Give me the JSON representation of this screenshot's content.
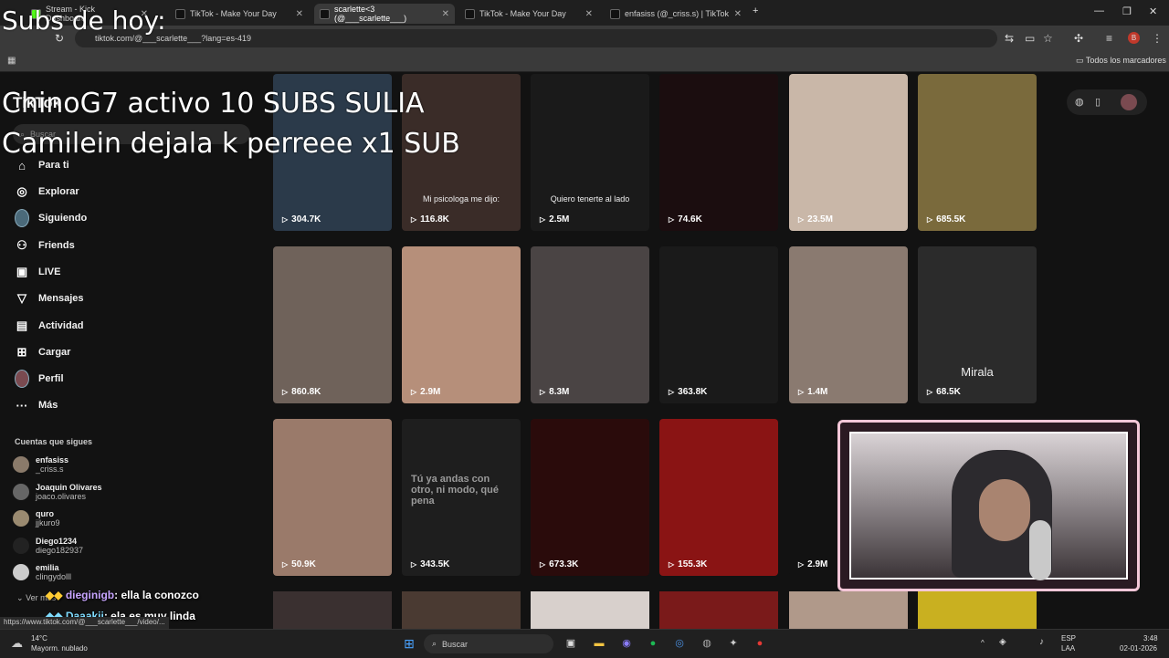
{
  "browser": {
    "tabs": [
      {
        "label": "Stream - Kick Dashboard",
        "active": false
      },
      {
        "label": "TikTok - Make Your Day",
        "active": false
      },
      {
        "label": "scarlette<3 (@___scarlette___)",
        "active": true
      },
      {
        "label": "TikTok - Make Your Day",
        "active": false
      },
      {
        "label": "enfasiss (@_criss.s) | TikTok",
        "active": false
      }
    ],
    "url": "tiktok.com/@___scarlette___?lang=es-419",
    "bookmarks_folder": "Todos los marcadores",
    "status_url": "https://www.tiktok.com/@___scarlette___/video/..."
  },
  "tiktok": {
    "logo": "TikTok",
    "search_placeholder": "Buscar",
    "nav": [
      {
        "label": "Para ti",
        "icon": "home-icon"
      },
      {
        "label": "Explorar",
        "icon": "compass-icon"
      },
      {
        "label": "Siguiendo",
        "icon": "avatar"
      },
      {
        "label": "Friends",
        "icon": "friends-icon"
      },
      {
        "label": "LIVE",
        "icon": "live-icon"
      },
      {
        "label": "Mensajes",
        "icon": "send-icon"
      },
      {
        "label": "Actividad",
        "icon": "activity-icon"
      },
      {
        "label": "Cargar",
        "icon": "upload-icon"
      },
      {
        "label": "Perfil",
        "icon": "profile-avatar"
      },
      {
        "label": "Más",
        "icon": "more-icon"
      }
    ],
    "following_heading": "Cuentas que sigues",
    "following": [
      {
        "name": "enfasiss",
        "handle": "_criss.s"
      },
      {
        "name": "Joaquin Olivares",
        "handle": "joaco.olivares"
      },
      {
        "name": "quro",
        "handle": "jjkuro9"
      },
      {
        "name": "Diego1234",
        "handle": "diego182937"
      },
      {
        "name": "emilia",
        "handle": "clingydolll"
      }
    ],
    "see_more": "Ver más",
    "videos": [
      {
        "views": "304.7K",
        "caption": "",
        "color": "#2b3a4a"
      },
      {
        "views": "116.8K",
        "caption": "Mi psicologa me dijo:",
        "color": "#3a2c28"
      },
      {
        "views": "2.5M",
        "caption": "Quiero tenerte al lado",
        "color": "#1a1a1a"
      },
      {
        "views": "74.6K",
        "caption": "",
        "color": "#1b0d0f"
      },
      {
        "views": "23.5M",
        "caption": "",
        "color": "#c9b7a8"
      },
      {
        "views": "685.5K",
        "caption": "",
        "color": "#7a6a3c"
      },
      {
        "views": "860.8K",
        "caption": "",
        "color": "#6f625a"
      },
      {
        "views": "2.9M",
        "caption": "",
        "color": "#b68f7a"
      },
      {
        "views": "8.3M",
        "caption": "",
        "color": "#4a4444"
      },
      {
        "views": "363.8K",
        "caption": "",
        "color": "#1a1a1a"
      },
      {
        "views": "1.4M",
        "caption": "",
        "color": "#8a7a70"
      },
      {
        "views": "68.5K",
        "caption": "Mirala",
        "color": "#2b2b2b"
      },
      {
        "views": "50.9K",
        "caption": "",
        "color": "#9a7a6a"
      },
      {
        "views": "343.5K",
        "caption": "Tú ya andas con otro, ni modo, qué pena",
        "color": "#1e1e1e"
      },
      {
        "views": "673.3K",
        "caption": "",
        "color": "#2a0b0b"
      },
      {
        "views": "155.3K",
        "caption": "",
        "color": "#8a1414"
      },
      {
        "views": "2.9M",
        "caption": "",
        "color": "#121212"
      }
    ]
  },
  "overlay": {
    "subs_title": "Subs de hoy:",
    "sub_lines": [
      "ChinoG7 activo 10 SUBS SULIA",
      "Camilein dejala k perreee x1 SUB"
    ],
    "chat": [
      {
        "user": "dieginigb",
        "message": ": ella la conozco",
        "color": "#c7a4ff"
      },
      {
        "user": "Daaakii",
        "message": ": ela es muy linda",
        "color": "#7fdcff"
      }
    ]
  },
  "taskbar": {
    "weather_temp": "14°C",
    "weather_desc": "Mayorm. nublado",
    "search_label": "Buscar",
    "lang_top": "ESP",
    "lang_bottom": "LAA",
    "time": "3:48",
    "date": "02-01-2026"
  }
}
